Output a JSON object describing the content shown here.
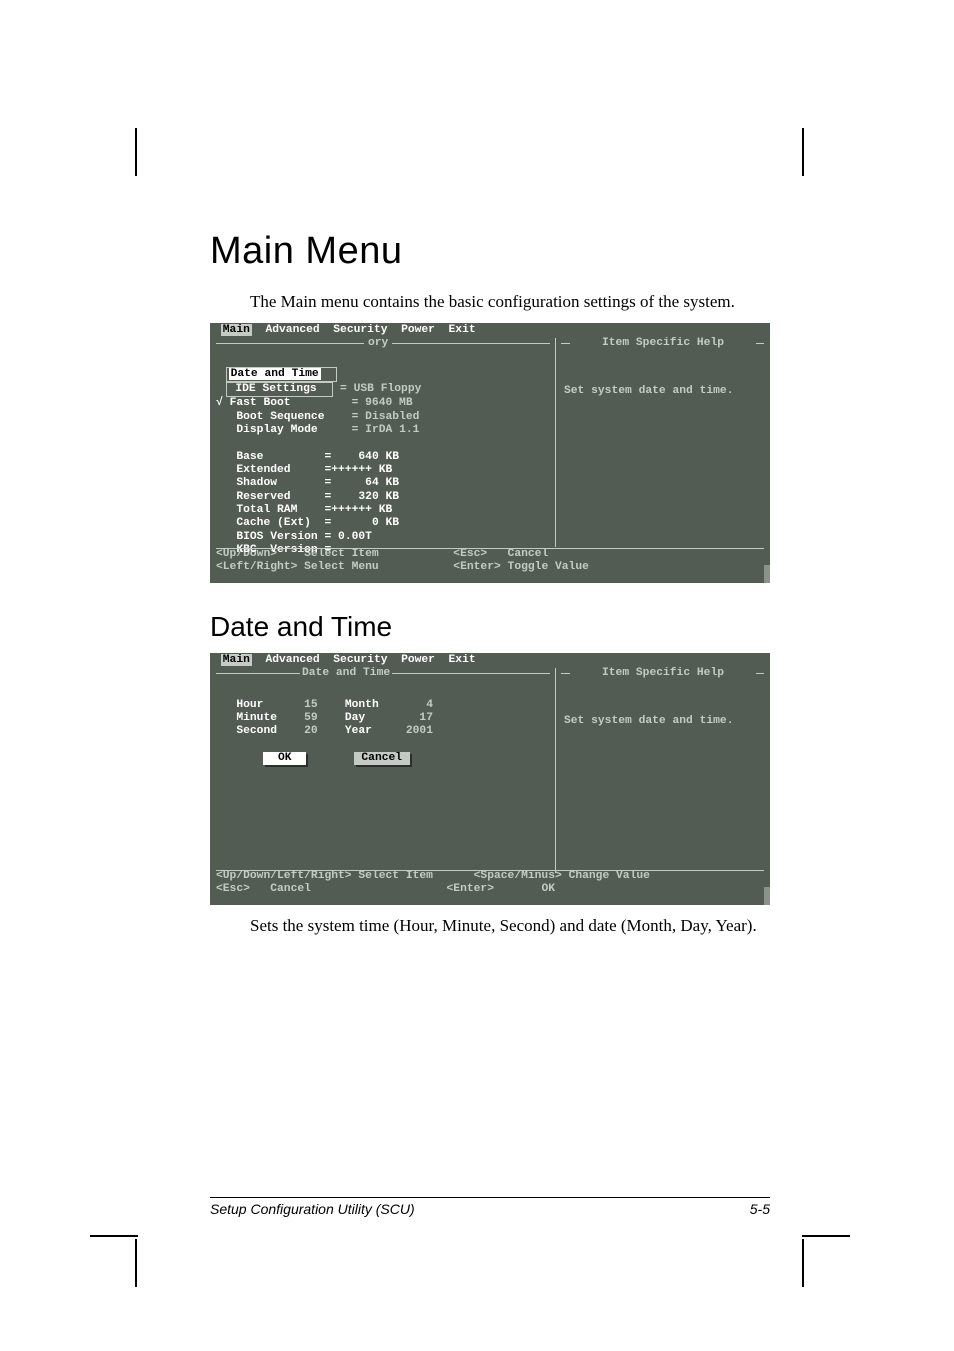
{
  "page": {
    "title": "Main Menu",
    "intro": "The Main menu contains the basic configuration settings of the system.",
    "sub_title": "Date and Time",
    "caption": "Sets the system time (Hour, Minute, Second) and date (Month, Day, Year).",
    "footer_left": "Setup Configuration Utility (SCU)",
    "footer_right": "5-5"
  },
  "bios1": {
    "menu": {
      "main": "Main",
      "advanced": "Advanced",
      "security": "Security",
      "power": "Power",
      "exit": "Exit"
    },
    "ory": "ory",
    "help_title": "Item Specific Help",
    "help_text": "Set system date and time.",
    "items": {
      "date_time": "Date and Time",
      "ide": "IDE Settings",
      "fast_boot_mark": "√",
      "fast_boot": "Fast Boot",
      "boot_seq": "Boot Sequence",
      "display_mode": "Display Mode"
    },
    "vals": {
      "ide": "= USB Floppy",
      "fast_boot": "= 9640 MB",
      "boot_seq": "= Disabled",
      "display_mode": "= IrDA 1.1"
    },
    "mem": {
      "base_l": "Base",
      "base_v": "=    640 KB",
      "ext_l": "Extended",
      "ext_v": "=++++++ KB",
      "shadow_l": "Shadow",
      "shadow_v": "=     64 KB",
      "reserved_l": "Reserved",
      "reserved_v": "=    320 KB",
      "total_l": "Total RAM",
      "total_v": "=++++++ KB",
      "cache_l": "Cache (Ext)",
      "cache_v": "=      0 KB",
      "biosver_l": "BIOS Version",
      "biosver_v": "= 0.00T",
      "kbc_l": "KBC  Version",
      "kbc_v": "="
    },
    "footer": {
      "updown": "<Up/Down>",
      "updown_t": "Select Item",
      "lr": "<Left/Right>",
      "lr_t": "Select Menu",
      "esc": "<Esc>",
      "esc_t": "Cancel",
      "enter": "<Enter>",
      "enter_t": "Toggle Value"
    }
  },
  "bios2": {
    "menu": {
      "main": "Main",
      "advanced": "Advanced",
      "security": "Security",
      "power": "Power",
      "exit": "Exit"
    },
    "box_title": "Date and Time",
    "help_title": "Item Specific Help",
    "help_text": "Set system date and time.",
    "fields": {
      "hour_l": "Hour",
      "hour_v": "15",
      "min_l": "Minute",
      "min_v": "59",
      "sec_l": "Second",
      "sec_v": "20",
      "month_l": "Month",
      "month_v": "4",
      "day_l": "Day",
      "day_v": "17",
      "year_l": "Year",
      "year_v": "2001"
    },
    "ok": "OK",
    "cancel": "Cancel",
    "footer": {
      "nav": "<Up/Down/Left/Right>",
      "nav_t": "Select Item",
      "esc": "<Esc>",
      "esc_t": "Cancel",
      "sp": "<Space/Minus>",
      "sp_t": "Change Value",
      "enter": "<Enter>",
      "enter_t": "OK"
    }
  }
}
